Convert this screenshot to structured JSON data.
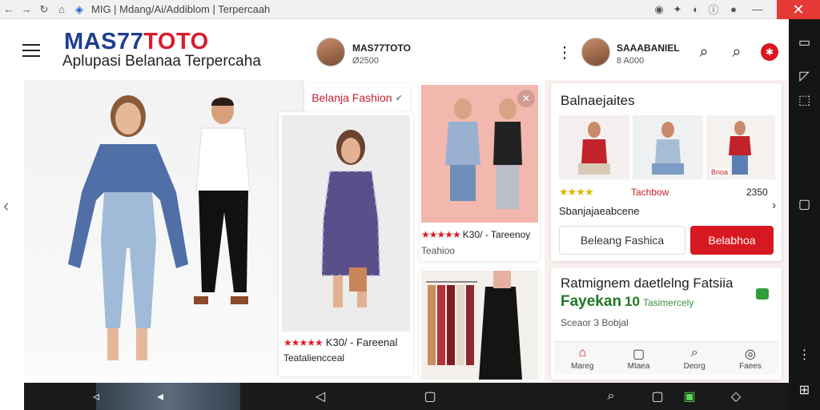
{
  "browser": {
    "tab_title": "MIG | Mdang/Ai/Addiblom | Terpercaah",
    "close_glyph": "✕"
  },
  "header": {
    "brand_part1": "MAS77",
    "brand_part2": "TOTO",
    "tagline": "Aplupasi Belanaa Terpercaha",
    "user1": {
      "name": "MAS77TOTO",
      "sub": "Ø2500"
    },
    "user2": {
      "name": "SAAABANIEL",
      "sub": "8 A000"
    },
    "colors": {
      "brand_blue": "#1d3f8f",
      "brand_red": "#d81d2c",
      "accent": "#d81820"
    }
  },
  "feature": {
    "label": "Belanja Fashion",
    "card1": {
      "title": "K30/ - Fareenal",
      "sub": "Teataliencceal",
      "stars": "★★★★★"
    },
    "card2": {
      "title": "K30/ - Tareenoy",
      "sub": "Teahioo",
      "stars": "★★★★★"
    }
  },
  "side": {
    "title": "Balnaejaites",
    "thumb_tag": "Bnoa",
    "rating_stars": "★★★★",
    "rating_label": "Tachbow",
    "price": "2350",
    "desc": "Sbanjajaeabcene",
    "btn_outline": "Beleang Fashica",
    "btn_red": "Belabhoa"
  },
  "promo": {
    "title": "Ratmignem daetlelng Fatsiia",
    "sub_green": "Fayekan",
    "sub_green_small": "Tasimercely",
    "sub_badge": "10",
    "note": "Sceaor 3 Bobjal"
  },
  "bottom_nav": [
    {
      "label": "Mareg",
      "icon": "home-icon",
      "glyph": "⌂"
    },
    {
      "label": "Mtaea",
      "icon": "square-icon",
      "glyph": "▢"
    },
    {
      "label": "Deorg",
      "icon": "search-icon",
      "glyph": "⌕"
    },
    {
      "label": "Faees",
      "icon": "circle-icon",
      "glyph": "◎"
    }
  ]
}
